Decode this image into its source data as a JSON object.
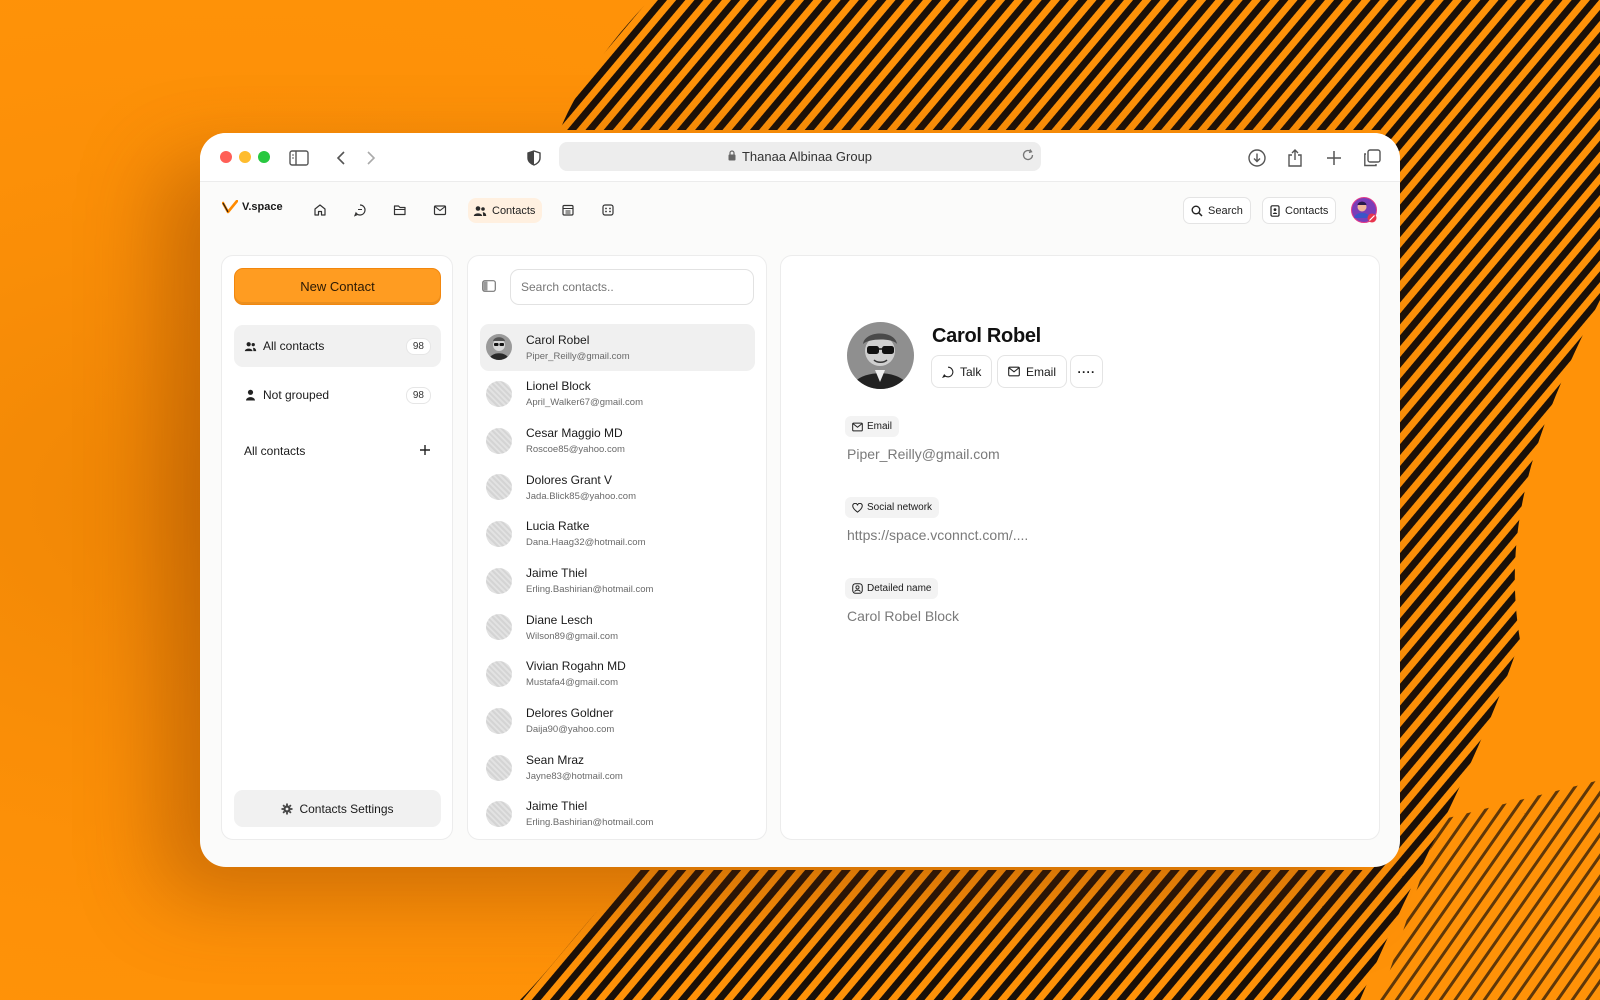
{
  "browser": {
    "url_title": "Thanaa Albinaa Group"
  },
  "app": {
    "brand": "V.space",
    "nav_active_label": "Contacts",
    "search_label": "Search",
    "contacts_label": "Contacts"
  },
  "sidebar": {
    "new_contact_label": "New Contact",
    "groups": [
      {
        "label": "All contacts",
        "count": "98"
      },
      {
        "label": "Not grouped",
        "count": "98"
      }
    ],
    "section_label": "All contacts",
    "settings_label": "Contacts Settings"
  },
  "contact_list": {
    "search_placeholder": "Search contacts..",
    "contacts": [
      {
        "name": "Carol Robel",
        "email": "Piper_Reilly@gmail.com"
      },
      {
        "name": "Lionel Block",
        "email": "April_Walker67@gmail.com"
      },
      {
        "name": "Cesar Maggio MD",
        "email": "Roscoe85@yahoo.com"
      },
      {
        "name": "Dolores Grant V",
        "email": "Jada.Blick85@yahoo.com"
      },
      {
        "name": "Lucia Ratke",
        "email": "Dana.Haag32@hotmail.com"
      },
      {
        "name": "Jaime Thiel",
        "email": "Erling.Bashirian@hotmail.com"
      },
      {
        "name": "Diane Lesch",
        "email": "Wilson89@gmail.com"
      },
      {
        "name": "Vivian Rogahn MD",
        "email": "Mustafa4@gmail.com"
      },
      {
        "name": "Delores Goldner",
        "email": "Daija90@yahoo.com"
      },
      {
        "name": "Sean Mraz",
        "email": "Jayne83@hotmail.com"
      },
      {
        "name": "Jaime Thiel",
        "email": "Erling.Bashirian@hotmail.com"
      }
    ]
  },
  "detail": {
    "name": "Carol Robel",
    "talk_label": "Talk",
    "email_label": "Email",
    "more_label": "····",
    "fields": [
      {
        "tag": "Email",
        "icon": "mail-icon",
        "value": "Piper_Reilly@gmail.com"
      },
      {
        "tag": "Social network",
        "icon": "heart-icon",
        "value": "https://space.vconnct.com/...."
      },
      {
        "tag": "Detailed name",
        "icon": "id-icon",
        "value": "Carol Robel Block"
      }
    ]
  },
  "colors": {
    "background": "#ff9208",
    "accent": "#ff9c21",
    "pattern": "#1a1008"
  }
}
